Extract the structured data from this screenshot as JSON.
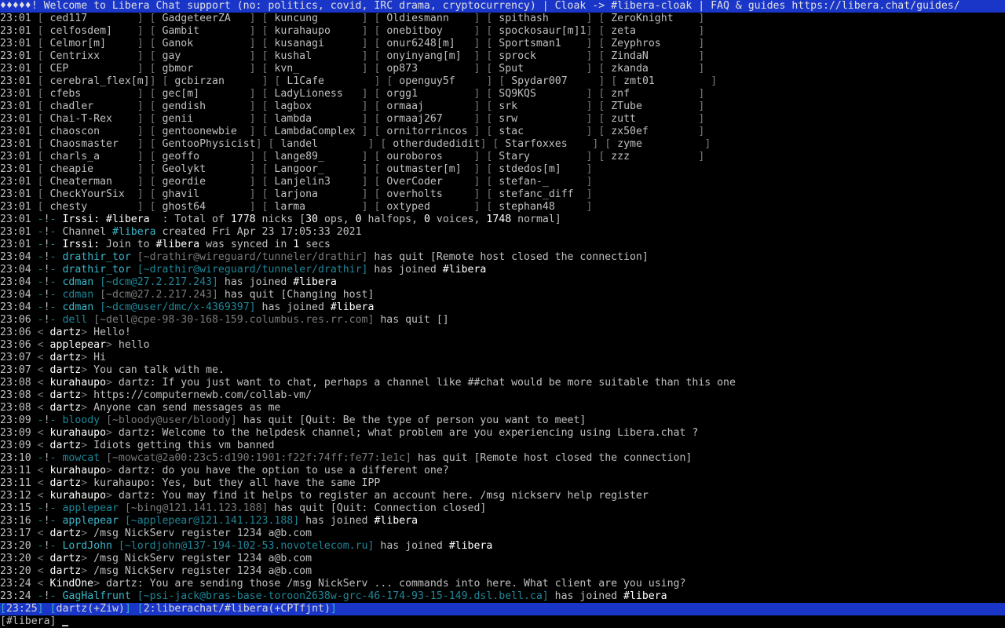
{
  "topic": "♦♦♦♦♦! Welcome to Libera Chat support (no: politics, covid, IRC drama, cryptocurrency) | Cloak -> #libera-cloak | FAQ & guides https://libera.chat/guides/",
  "names_time": "23:01",
  "names_columns": [
    [
      "ced117",
      "celfosdem]",
      "Celmor[m]",
      "Centrixx",
      "CEP",
      "cerebral_flex[m]",
      "cfebs",
      "chadler",
      "Chai-T-Rex",
      "chaoscon",
      "Chaosmaster",
      "charls_a",
      "cheapie",
      "Cheaterman",
      "CheckYourSix",
      "chesty"
    ],
    [
      "GadgeteerZA",
      "Gambit",
      "Ganok",
      "gay",
      "gbmor",
      "gcbirzan",
      "gec[m]",
      "gendish",
      "genii",
      "gentoonewbie",
      "GentooPhysicist",
      "geoffo",
      "Geolykt",
      "geordie",
      "ghavil",
      "ghost64"
    ],
    [
      "kuncung",
      "kurahaupo",
      "kusanagi",
      "kushal",
      "kvn_",
      "L1Cafe",
      "LadyLioness",
      "lagbox",
      "lambda",
      "LambdaComplex",
      "landel",
      "lange89_",
      "Langoor_",
      "Lanjelin3",
      "larjona",
      "larma"
    ],
    [
      "Oldiesmann",
      "onebitboy",
      "onur6248[m]",
      "onyinyang[m]",
      "op873",
      "openguy5f",
      "orgg1",
      "ormaaj",
      "ormaaj267",
      "ornitorrincos",
      "otherdudedidit",
      "ouroboros",
      "outmaster[m]",
      "OverCoder",
      "overholts",
      "oxtyped"
    ],
    [
      "spithash",
      "spockosaur[m]1",
      "Sportsman1",
      "sprock",
      "Sput",
      "Spydar007",
      "SQ9KQS",
      "srk",
      "srw",
      "stac",
      "Starfoxxes",
      "Stary",
      "stdedos[m]",
      "stefan-_",
      "stefanc_diff",
      "stephan48"
    ],
    [
      "ZeroKnight",
      "zeta",
      "Zeyphros",
      "ZindaN",
      "zkanda",
      "zmt01",
      "znf",
      "ZTube",
      "zutt",
      "zx50ef",
      "zyme",
      "zzz",
      "",
      "",
      "",
      ""
    ]
  ],
  "events": [
    {
      "kind": "info",
      "t": "23:01",
      "parts": [
        [
          "bold",
          "Irssi: "
        ],
        [
          "bold",
          "#libera"
        ],
        [
          "",
          "  : Total of "
        ],
        [
          "bold",
          "1778"
        ],
        [
          "",
          " nicks ["
        ],
        [
          "bold",
          "30"
        ],
        [
          "",
          " ops, "
        ],
        [
          "bold",
          "0"
        ],
        [
          "",
          " halfops, "
        ],
        [
          "bold",
          "0"
        ],
        [
          "",
          " voices, "
        ],
        [
          "bold",
          "1748"
        ],
        [
          "",
          " normal]"
        ]
      ]
    },
    {
      "kind": "info",
      "t": "23:01",
      "parts": [
        [
          "",
          "Channel "
        ],
        [
          "cyan",
          "#libera"
        ],
        [
          "",
          " created Fri Apr 23 17:05:33 2021"
        ]
      ]
    },
    {
      "kind": "info",
      "t": "23:01",
      "parts": [
        [
          "bold",
          "Irssi: "
        ],
        [
          "",
          "Join to "
        ],
        [
          "bold",
          "#libera"
        ],
        [
          "",
          " was synced in "
        ],
        [
          "bold",
          "1"
        ],
        [
          "",
          " secs"
        ]
      ]
    },
    {
      "kind": "info",
      "t": "23:04",
      "parts": [
        [
          "cyan",
          "drathir_tor "
        ],
        [
          "dim",
          "[~drathir@wireguard/tunneler/drathir]"
        ],
        [
          "",
          " has quit [Remote host closed the connection]"
        ]
      ]
    },
    {
      "kind": "info",
      "t": "23:04",
      "parts": [
        [
          "cyan",
          "drathir_tor "
        ],
        [
          "cyan-dim",
          "[~drathir@wireguard/tunneler/drathir]"
        ],
        [
          "",
          " has joined "
        ],
        [
          "bold",
          "#libera"
        ]
      ]
    },
    {
      "kind": "info",
      "t": "23:04",
      "parts": [
        [
          "cyan",
          "cdman "
        ],
        [
          "cyan-dim",
          "[~dcm@27.2.217.243]"
        ],
        [
          "",
          " has joined "
        ],
        [
          "bold",
          "#libera"
        ]
      ]
    },
    {
      "kind": "info",
      "t": "23:04",
      "parts": [
        [
          "cyan-dim",
          "cdman "
        ],
        [
          "dim",
          "[~dcm@27.2.217.243]"
        ],
        [
          "",
          " has quit [Changing host]"
        ]
      ]
    },
    {
      "kind": "info",
      "t": "23:04",
      "parts": [
        [
          "cyan",
          "cdman "
        ],
        [
          "cyan-dim",
          "[~dcm@user/dmc/x-4369397]"
        ],
        [
          "",
          " has joined "
        ],
        [
          "bold",
          "#libera"
        ]
      ]
    },
    {
      "kind": "info",
      "t": "23:06",
      "parts": [
        [
          "cyan-dim",
          "dell "
        ],
        [
          "dim",
          "[~dell@cpe-98-30-168-159.columbus.res.rr.com]"
        ],
        [
          "",
          " has quit []"
        ]
      ]
    },
    {
      "kind": "msg",
      "t": "23:06",
      "nick": "dartz",
      "text": "Hello!"
    },
    {
      "kind": "msg",
      "t": "23:06",
      "nick": "applepear",
      "text": "hello"
    },
    {
      "kind": "msg",
      "t": "23:07",
      "nick": "dartz",
      "text": "Hi"
    },
    {
      "kind": "msg",
      "t": "23:07",
      "nick": "dartz",
      "text": "You can talk with me."
    },
    {
      "kind": "msg",
      "t": "23:08",
      "nick": "kurahaupo",
      "text": "dartz: If you just want to chat, perhaps a channel like ##chat would be more suitable than this one"
    },
    {
      "kind": "msg",
      "t": "23:08",
      "nick": "dartz",
      "text": "https://computernewb.com/collab-vm/"
    },
    {
      "kind": "msg",
      "t": "23:08",
      "nick": "dartz",
      "text": "Anyone can send messages as me"
    },
    {
      "kind": "info",
      "t": "23:09",
      "parts": [
        [
          "cyan-dim",
          "bloody "
        ],
        [
          "dim",
          "[~bloody@user/bloody]"
        ],
        [
          "",
          " has quit [Quit: Be the type of person you want to meet]"
        ]
      ]
    },
    {
      "kind": "msg",
      "t": "23:09",
      "nick": "kurahaupo",
      "text": "dartz: Welcome to the helpdesk channel; what problem are you experiencing using Libera.chat ?"
    },
    {
      "kind": "msg",
      "t": "23:09",
      "nick": "dartz",
      "text": "Idiots getting this vm banned"
    },
    {
      "kind": "info",
      "t": "23:10",
      "parts": [
        [
          "cyan-dim",
          "mowcat "
        ],
        [
          "dim",
          "[~mowcat@2a00:23c5:d190:1901:f22f:74ff:fe77:1e1c]"
        ],
        [
          "",
          " has quit [Remote host closed the connection]"
        ]
      ]
    },
    {
      "kind": "msg",
      "t": "23:11",
      "nick": "kurahaupo",
      "text": "dartz: do you have the option to use a different one?"
    },
    {
      "kind": "msg",
      "t": "23:11",
      "nick": "dartz",
      "text": "kurahaupo: Yes, but they all have the same IPP"
    },
    {
      "kind": "msg",
      "t": "23:12",
      "nick": "kurahaupo",
      "text": "dartz: You may find it helps to register an account here. /msg nickserv help register"
    },
    {
      "kind": "info",
      "t": "23:15",
      "parts": [
        [
          "cyan-dim",
          "applepear "
        ],
        [
          "dim",
          "[~bing@121.141.123.188]"
        ],
        [
          "",
          " has quit [Quit: Connection closed]"
        ]
      ]
    },
    {
      "kind": "info",
      "t": "23:16",
      "parts": [
        [
          "cyan",
          "applepear "
        ],
        [
          "cyan-dim",
          "[~applepear@121.141.123.188]"
        ],
        [
          "",
          " has joined "
        ],
        [
          "bold",
          "#libera"
        ]
      ]
    },
    {
      "kind": "msg",
      "t": "23:17",
      "nick": "dartz",
      "text": "/msg NickServ register 1234 a@b.com"
    },
    {
      "kind": "info",
      "t": "23:20",
      "parts": [
        [
          "cyan",
          "LordJohn "
        ],
        [
          "cyan-dim",
          "[~lordjohn@137-194-102-53.novotelecom.ru]"
        ],
        [
          "",
          " has joined "
        ],
        [
          "bold",
          "#libera"
        ]
      ]
    },
    {
      "kind": "msg",
      "t": "23:20",
      "nick": "dartz",
      "text": "/msg NickServ register 1234 a@b.com"
    },
    {
      "kind": "msg",
      "t": "23:20",
      "nick": "dartz",
      "text": "/msg NickServ register 1234 a@b.com"
    },
    {
      "kind": "msg",
      "t": "23:24",
      "nick": "KindOne",
      "text": "dartz: You are sending those /msg NickServ ... commands into here. What client are you using?"
    },
    {
      "kind": "info",
      "t": "23:24",
      "parts": [
        [
          "cyan",
          "GagHalfrunt "
        ],
        [
          "cyan-dim",
          "[~psi-jack@bras-base-toroon2638w-grc-46-174-93-15-149.dsl.bell.ca]"
        ],
        [
          "",
          " has joined "
        ],
        [
          "bold",
          "#libera"
        ]
      ]
    }
  ],
  "statusbar": {
    "time": "23:25",
    "nick": "dartz(+Ziw)",
    "window": "2:liberachat/#libera(+CPTfjnt)"
  },
  "input": {
    "prompt": "[#libera]",
    "value": ""
  }
}
